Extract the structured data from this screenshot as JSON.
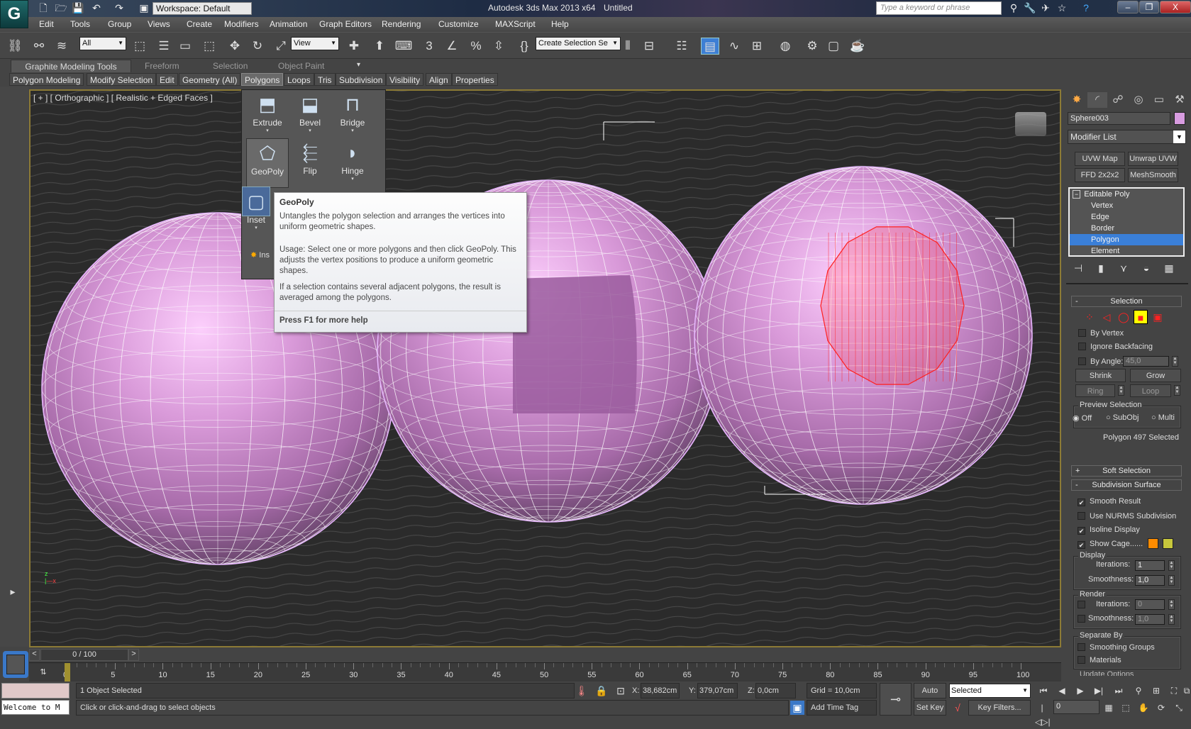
{
  "app": {
    "title": "Autodesk 3ds Max  2013 x64",
    "document": "Untitled",
    "logo": "3ds-max-logo",
    "workspace": "Workspace: Default",
    "search_placeholder": "Type a keyword or phrase",
    "quick_access": [
      "new-file-icon",
      "open-file-icon",
      "save-icon",
      "undo-icon",
      "redo-icon",
      "project-folder-icon"
    ],
    "help_icons": [
      "binoculars-icon",
      "key-icon",
      "satellite-icon",
      "star-icon",
      "help-icon"
    ],
    "window_controls": {
      "minimize": "–",
      "restore": "❐",
      "close": "X"
    }
  },
  "menu": [
    "Edit",
    "Tools",
    "Group",
    "Views",
    "Create",
    "Modifiers",
    "Animation",
    "Graph Editors",
    "Rendering",
    "Customize",
    "MAXScript",
    "Help"
  ],
  "toolbar": {
    "selection_filter": "All",
    "ref_coord": "View",
    "named_selection": "Create Selection Se",
    "snap_label": "3",
    "icons": [
      "select-and-link-icon",
      "unlink-icon",
      "bind-space-warp-icon",
      "select-object-icon",
      "select-by-name-icon",
      "rectangular-selection-icon",
      "window-crossing-icon",
      "move-icon",
      "rotate-icon",
      "scale-icon",
      "pivot-center-icon",
      "manipulate-icon",
      "keyboard-shortcut-icon",
      "snaps-toggle-icon",
      "angle-snap-icon",
      "percent-snap-icon",
      "spinner-snap-icon",
      "edit-named-sets-icon",
      "mirror-icon",
      "align-icon",
      "layer-manager-icon",
      "graphite-toggle-icon",
      "curve-editor-icon",
      "schematic-view-icon",
      "material-editor-icon",
      "render-setup-icon",
      "rendered-frame-icon",
      "render-icon"
    ]
  },
  "ribbon": {
    "tabs": [
      "Graphite Modeling Tools",
      "Freeform",
      "Selection",
      "Object Paint"
    ],
    "active_tab": 0,
    "subtabs": [
      "Polygon Modeling",
      "Modify Selection",
      "Edit",
      "Geometry (All)",
      "Polygons",
      "Loops",
      "Tris",
      "Subdivision",
      "Visibility",
      "Align",
      "Properties"
    ],
    "active_subtab": 4,
    "panel": {
      "buttons": [
        {
          "label": "Extrude",
          "icon": "extrude-icon"
        },
        {
          "label": "Bevel",
          "icon": "bevel-icon"
        },
        {
          "label": "Bridge",
          "icon": "bridge-icon"
        },
        {
          "label": "GeoPoly",
          "icon": "geopoly-icon"
        },
        {
          "label": "Flip",
          "icon": "flip-icon"
        },
        {
          "label": "Hinge",
          "icon": "hinge-icon"
        },
        {
          "label": "Inset",
          "icon": "inset-icon"
        }
      ],
      "bottom_label": "Ins"
    }
  },
  "tooltip": {
    "title": "GeoPoly",
    "desc": "Untangles the polygon selection and arranges the vertices into uniform geometric shapes.",
    "usage": "Usage: Select one or more polygons and then click GeoPoly. This adjusts the vertex positions to produce a uniform geometric shapes.",
    "note": "If a selection contains several adjacent polygons, the result is averaged among the polygons.",
    "help": "Press F1 for more help"
  },
  "viewport": {
    "label": "[ + ] [ Orthographic ] [ Realistic + Edged Faces ]",
    "object_color": "#d89ad8",
    "selection_color": "#ff2020"
  },
  "command_panel": {
    "tabs": [
      "create-icon",
      "modify-icon",
      "hierarchy-icon",
      "motion-icon",
      "display-icon",
      "utilities-icon"
    ],
    "object_name": "Sphere003",
    "object_color": "#d89ce0",
    "modifier_list": "Modifier List",
    "modifier_buttons": [
      "UVW Map",
      "Unwrap UVW",
      "FFD 2x2x2",
      "MeshSmooth"
    ],
    "stack": {
      "root": "Editable Poly",
      "items": [
        "Vertex",
        "Edge",
        "Border",
        "Polygon",
        "Element"
      ],
      "selected": "Polygon"
    },
    "stack_tools": [
      "pin-stack-icon",
      "show-end-result-icon",
      "make-unique-icon",
      "remove-modifier-icon",
      "configure-sets-icon"
    ],
    "selection": {
      "title": "Selection",
      "levels": [
        "vertex-level-icon",
        "edge-level-icon",
        "border-level-icon",
        "polygon-level-icon",
        "element-level-icon"
      ],
      "active_level": 3,
      "by_vertex": "By Vertex",
      "ignore_backfacing": "Ignore Backfacing",
      "by_angle": "By Angle:",
      "angle_value": "45,0",
      "shrink": "Shrink",
      "grow": "Grow",
      "ring": "Ring",
      "loop": "Loop",
      "preview": {
        "title": "Preview Selection",
        "options": [
          "Off",
          "SubObj",
          "Multi"
        ],
        "selected": "Off"
      },
      "status": "Polygon 497 Selected"
    },
    "soft_selection": {
      "title": "Soft Selection"
    },
    "subdivision": {
      "title": "Subdivision Surface",
      "smooth_result": "Smooth Result",
      "use_nurms": "Use NURMS Subdivision",
      "isoline": "Isoline Display",
      "show_cage": "Show Cage......",
      "cage_colors": [
        "#ff8c00",
        "#c8c83c"
      ],
      "display": {
        "title": "Display",
        "iterations_label": "Iterations:",
        "iterations": "1",
        "smoothness_label": "Smoothness:",
        "smoothness": "1,0"
      },
      "render": {
        "title": "Render",
        "iterations_label": "Iterations:",
        "iterations": "0",
        "smoothness_label": "Smoothness:",
        "smoothness": "1,0"
      },
      "separate": {
        "title": "Separate By",
        "smoothing_groups": "Smoothing Groups",
        "materials": "Materials"
      },
      "update_options": "Update Options"
    }
  },
  "timeline": {
    "frame": "0 / 100",
    "ticks": [
      "0",
      "5",
      "10",
      "15",
      "20",
      "25",
      "30",
      "35",
      "40",
      "45",
      "50",
      "55",
      "60",
      "65",
      "70",
      "75",
      "80",
      "85",
      "90",
      "95",
      "100"
    ]
  },
  "status": {
    "maxscript_output": "",
    "maxscript_input": "Welcome to M",
    "selection": "1 Object Selected",
    "prompt": "Click or click-and-drag to select objects",
    "x_label": "X:",
    "x": "38,682cm",
    "y_label": "Y:",
    "y": "379,07cm",
    "z_label": "Z:",
    "z": "0,0cm",
    "grid": "Grid = 10,0cm",
    "add_time_tag": "Add Time Tag",
    "auto_key": "Auto Key",
    "set_key": "Set Key",
    "key_mode": "Selected",
    "key_filters": "Key Filters...",
    "current_frame": "0"
  }
}
